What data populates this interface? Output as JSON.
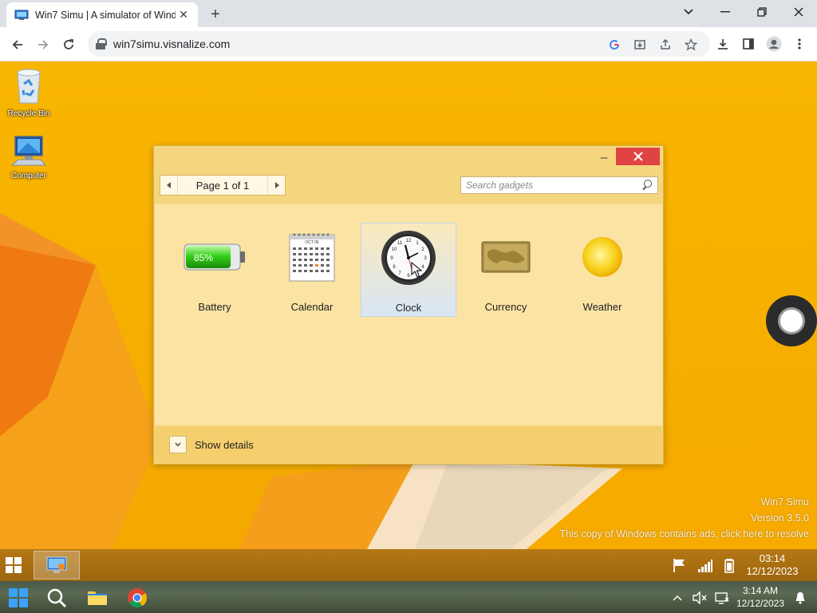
{
  "browser": {
    "tab_title": "Win7 Simu | A simulator of Wind",
    "url": "win7simu.visnalize.com",
    "new_tab_symbol": "+",
    "close_tab_symbol": "✕"
  },
  "desktop": {
    "icons": [
      {
        "label": "Recycle Bin"
      },
      {
        "label": "Computer"
      }
    ],
    "watermark": {
      "line1": "Win7 Simu",
      "line2": "Version 3.5.0",
      "line3": "This copy of Windows contains ads, click here to resolve"
    }
  },
  "gadget_window": {
    "page_label": "Page 1 of 1",
    "search_placeholder": "Search gadgets",
    "gadgets": [
      {
        "name": "Battery",
        "level_text": "85%",
        "level": 0.85
      },
      {
        "name": "Calendar",
        "month_text": "OCT 06"
      },
      {
        "name": "Clock",
        "selected": true
      },
      {
        "name": "Currency"
      },
      {
        "name": "Weather"
      }
    ],
    "show_details_label": "Show details"
  },
  "taskbar_sim": {
    "time": "03:14",
    "date": "12/12/2023"
  },
  "taskbar_host": {
    "time": "3:14 AM",
    "date": "12/12/2023"
  },
  "colors": {
    "desktop_bg": "#f6b000",
    "window_bg": "#f5d67e",
    "close_red": "#e04343",
    "selected_tile": "#d7e6f5"
  }
}
